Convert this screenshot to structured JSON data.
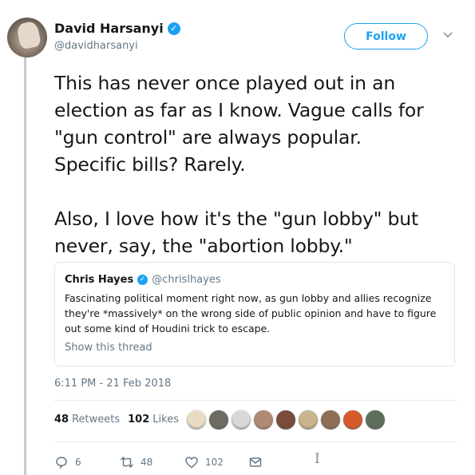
{
  "author": {
    "display_name": "David Harsanyi",
    "handle": "@davidharsanyi"
  },
  "follow_button": {
    "label": "Follow"
  },
  "tweet": {
    "text": "This has never once played out in an\nelection as far as I know. Vague calls for\n\"gun control\" are always popular.\nSpecific bills? Rarely.\n\nAlso, I love how it's the \"gun lobby\" but\nnever, say, the \"abortion lobby.\""
  },
  "quoted_tweet": {
    "display_name": "Chris Hayes",
    "handle": "@chrislhayes",
    "text": "Fascinating political moment right now, as gun lobby and allies recognize\nthey're *massively* on the wrong side of public opinion and have to figure\nout some kind of Houdini trick to escape.",
    "show_thread": "Show this thread"
  },
  "timestamp": "6:11 PM - 21 Feb 2018",
  "stats": {
    "retweets_count": "48",
    "retweets_label": "Retweets",
    "likes_count": "102",
    "likes_label": "Likes"
  },
  "liker_avatar_colors": [
    "#e9dcc2",
    "#6f6a62",
    "#d8d8d8",
    "#b08a74",
    "#7a4a3a",
    "#c9b48c",
    "#8e6f55",
    "#d65b2a",
    "#5e6e58"
  ],
  "actions": {
    "reply_count": "6",
    "retweet_count": "48",
    "like_count": "102"
  },
  "colors": {
    "accent": "#1da1f2",
    "secondary_text": "#657786",
    "border": "#e1e8ed"
  },
  "icons": [
    "verified-badge-icon",
    "chevron-down-icon",
    "reply-icon",
    "retweet-icon",
    "heart-icon",
    "envelope-icon",
    "text-cursor-icon"
  ]
}
